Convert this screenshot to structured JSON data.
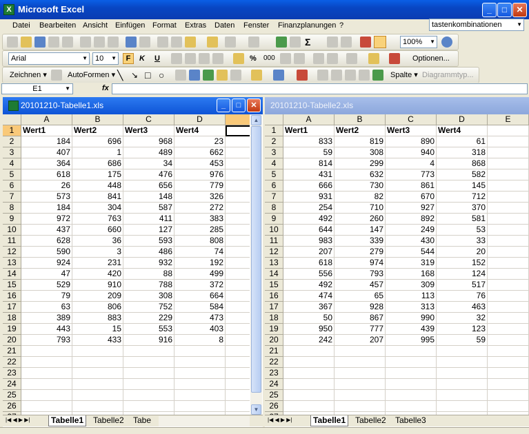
{
  "app": {
    "title": "Microsoft Excel",
    "icon_letter": "X",
    "help_box_value": "tastenkombinationen"
  },
  "window_controls": {
    "minimize": "_",
    "maximize": "□",
    "close": "✕"
  },
  "menu": [
    "Datei",
    "Bearbeiten",
    "Ansicht",
    "Einfügen",
    "Format",
    "Extras",
    "Daten",
    "Fenster",
    "Finanzplanungen",
    "?"
  ],
  "toolbar": {
    "zoom": "100%",
    "font_name": "Arial",
    "font_size": "10",
    "bold": "F",
    "italic": "K",
    "underline": "U",
    "percent": "%",
    "thousands": "000",
    "options_label": "Optionen...",
    "drawing_label": "Zeichnen",
    "autoshapes_label": "AutoFormen",
    "column_label": "Spalte",
    "diagram_label": "Diagrammtyp..."
  },
  "formula_bar": {
    "name_box": "E1",
    "fx": "fx",
    "value": ""
  },
  "colors": {
    "title_blue": "#0A5FE6",
    "active_header": "#F9C979",
    "inactive_title": "#A7BEEA"
  },
  "workbooks": [
    {
      "title": "20101210-Tabelle1.xls",
      "active": true,
      "columns": [
        "A",
        "B",
        "C",
        "D",
        ""
      ],
      "rows_shown": 27,
      "headers": [
        "Wert1",
        "Wert2",
        "Wert3",
        "Wert4"
      ],
      "data": [
        [
          184,
          696,
          968,
          23
        ],
        [
          407,
          1,
          489,
          662
        ],
        [
          364,
          686,
          34,
          453
        ],
        [
          618,
          175,
          476,
          976
        ],
        [
          26,
          448,
          656,
          779
        ],
        [
          573,
          841,
          148,
          326
        ],
        [
          184,
          304,
          587,
          272
        ],
        [
          972,
          763,
          411,
          383
        ],
        [
          437,
          660,
          127,
          285
        ],
        [
          628,
          36,
          593,
          808
        ],
        [
          590,
          3,
          486,
          74
        ],
        [
          924,
          231,
          932,
          192
        ],
        [
          47,
          420,
          88,
          499
        ],
        [
          529,
          910,
          788,
          372
        ],
        [
          79,
          209,
          308,
          664
        ],
        [
          63,
          806,
          752,
          584
        ],
        [
          389,
          883,
          229,
          473
        ],
        [
          443,
          15,
          553,
          403
        ],
        [
          793,
          433,
          916,
          8
        ]
      ],
      "sheet_tabs": [
        "Tabelle1",
        "Tabelle2",
        "Tabe"
      ],
      "active_tab": 0
    },
    {
      "title": "20101210-Tabelle2.xls",
      "active": false,
      "columns": [
        "A",
        "B",
        "C",
        "D",
        "E"
      ],
      "rows_shown": 27,
      "headers": [
        "Wert1",
        "Wert2",
        "Wert3",
        "Wert4"
      ],
      "data": [
        [
          833,
          819,
          890,
          61
        ],
        [
          59,
          308,
          940,
          318
        ],
        [
          814,
          299,
          4,
          868
        ],
        [
          431,
          632,
          773,
          582
        ],
        [
          666,
          730,
          861,
          145
        ],
        [
          931,
          82,
          670,
          712
        ],
        [
          254,
          710,
          927,
          370
        ],
        [
          492,
          260,
          892,
          581
        ],
        [
          644,
          147,
          249,
          53
        ],
        [
          983,
          339,
          430,
          33
        ],
        [
          207,
          279,
          544,
          20
        ],
        [
          618,
          974,
          319,
          152
        ],
        [
          556,
          793,
          168,
          124
        ],
        [
          492,
          457,
          309,
          517
        ],
        [
          474,
          65,
          113,
          76
        ],
        [
          367,
          928,
          313,
          463
        ],
        [
          50,
          867,
          990,
          32
        ],
        [
          950,
          777,
          439,
          123
        ],
        [
          242,
          207,
          995,
          59
        ]
      ],
      "sheet_tabs": [
        "Tabelle1",
        "Tabelle2",
        "Tabelle3"
      ],
      "active_tab": 0
    }
  ]
}
